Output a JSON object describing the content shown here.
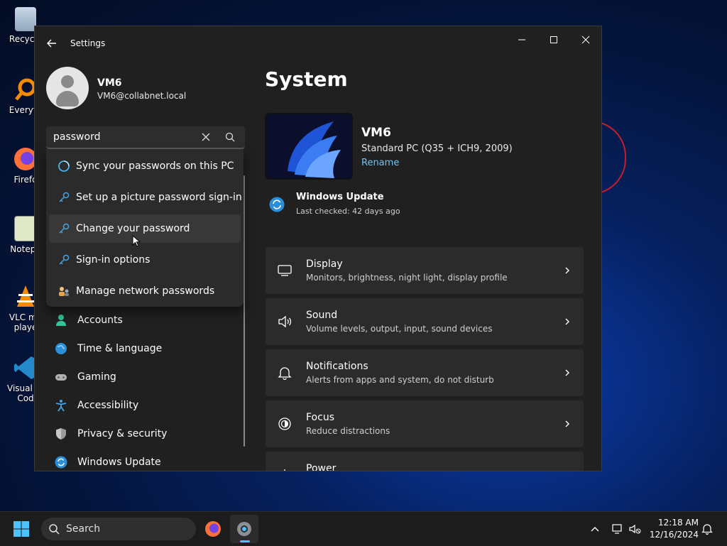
{
  "desktop": {
    "icons": [
      {
        "label": "Recycle",
        "name": "recycle-bin"
      },
      {
        "label": "Everyth",
        "name": "everything"
      },
      {
        "label": "Firefo",
        "name": "firefox"
      },
      {
        "label": "Notepa",
        "name": "notepad"
      },
      {
        "label": "VLC me\nplaye",
        "name": "vlc"
      },
      {
        "label": "Visual St\nCod",
        "name": "vscode"
      }
    ]
  },
  "window": {
    "title": "Settings",
    "controls": {
      "minimize": "—",
      "maximize": "☐",
      "close": "✕"
    }
  },
  "user": {
    "name": "VM6",
    "email": "VM6@collabnet.local"
  },
  "search": {
    "value": "password",
    "suggestions": [
      {
        "label": "Sync your passwords on this PC",
        "icon": "sync-icon"
      },
      {
        "label": "Set up a picture password sign-in",
        "icon": "key-icon"
      },
      {
        "label": "Change your password",
        "icon": "key-icon"
      },
      {
        "label": "Sign-in options",
        "icon": "key-icon"
      },
      {
        "label": "Manage network passwords",
        "icon": "network-users-icon"
      }
    ]
  },
  "nav": {
    "items": [
      {
        "label": "Accounts",
        "icon": "accounts-icon"
      },
      {
        "label": "Time & language",
        "icon": "globe-icon"
      },
      {
        "label": "Gaming",
        "icon": "gamepad-icon"
      },
      {
        "label": "Accessibility",
        "icon": "accessibility-icon"
      },
      {
        "label": "Privacy & security",
        "icon": "shield-icon"
      },
      {
        "label": "Windows Update",
        "icon": "update-icon"
      }
    ]
  },
  "main": {
    "title": "System",
    "device": {
      "name": "VM6",
      "model": "Standard PC (Q35 + ICH9, 2009)",
      "rename": "Rename"
    },
    "update": {
      "title": "Windows Update",
      "status": "Last checked: 42 days ago"
    },
    "cards": [
      {
        "title": "Display",
        "subtitle": "Monitors, brightness, night light, display profile",
        "icon": "monitor-icon"
      },
      {
        "title": "Sound",
        "subtitle": "Volume levels, output, input, sound devices",
        "icon": "speaker-icon"
      },
      {
        "title": "Notifications",
        "subtitle": "Alerts from apps and system, do not disturb",
        "icon": "bell-icon"
      },
      {
        "title": "Focus",
        "subtitle": "Reduce distractions",
        "icon": "focus-icon"
      },
      {
        "title": "Power",
        "subtitle": "",
        "icon": "power-icon"
      }
    ]
  },
  "taskbar": {
    "search_label": "Search",
    "time": "12:18 AM",
    "date": "12/16/2024"
  },
  "colors": {
    "accent": "#4cc2ff",
    "link": "#6fc3f5",
    "window_bg": "#202020",
    "card_bg": "#2b2b2b"
  }
}
